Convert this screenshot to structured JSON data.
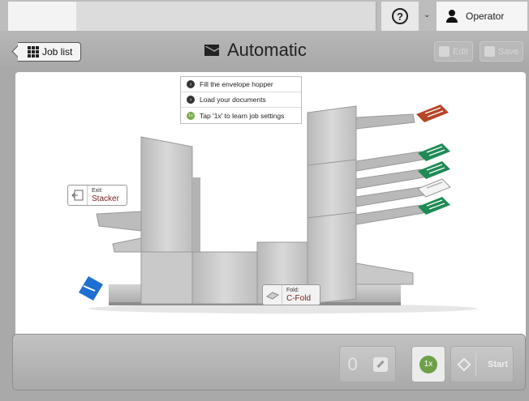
{
  "status_bar": {
    "help_symbol": "?",
    "user_label": "Operator",
    "user_icon": "user-icon",
    "dropdown_icon": "chevron-down-icon"
  },
  "header": {
    "back_label": "Job list",
    "title": "Automatic",
    "title_icon": "envelope-icon",
    "edit_label": "Edit",
    "save_label": "Save"
  },
  "main": {
    "tips": [
      "Fill the envelope hopper",
      "Load your documents",
      "Tap '1x' to learn job settings"
    ],
    "tip_badge_3": "1x",
    "exit": {
      "key": "Exit:",
      "value": "Stacker"
    },
    "fold": {
      "key": "Fold:",
      "value": "C-Fold"
    },
    "colors": {
      "document_red": "#b5462a",
      "document_green": "#1f8a55",
      "envelope_blue": "#1e6fd1",
      "machine_gray": "#c4c4c4",
      "value_text": "#7a1f1f"
    }
  },
  "controls": {
    "counter_value": "0",
    "onex_label": "1x",
    "start_label": "Start",
    "onex_color": "#6ea04a"
  }
}
